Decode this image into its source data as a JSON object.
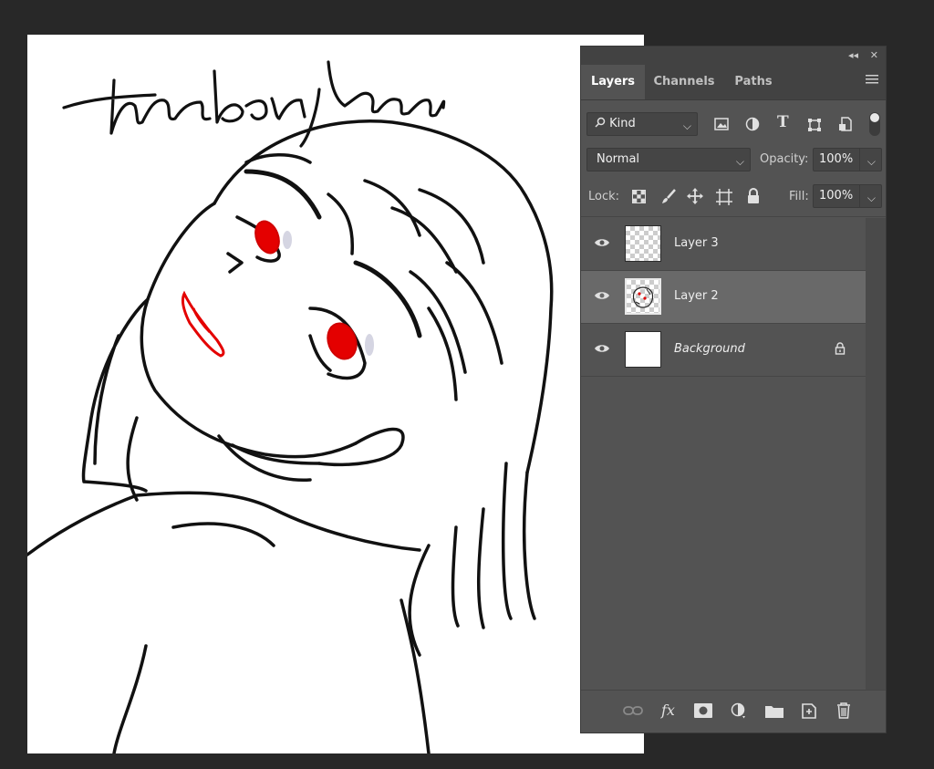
{
  "panel": {
    "tabs": [
      {
        "label": "Layers",
        "active": true
      },
      {
        "label": "Channels",
        "active": false
      },
      {
        "label": "Paths",
        "active": false
      }
    ],
    "filter": {
      "label": "Kind"
    },
    "blend_mode": "Normal",
    "opacity": {
      "label": "Opacity:",
      "value": "100%"
    },
    "lock": {
      "label": "Lock:"
    },
    "fill": {
      "label": "Fill:",
      "value": "100%"
    },
    "layers": [
      {
        "name": "Layer 3",
        "visible": true,
        "selected": false
      },
      {
        "name": "Layer 2",
        "visible": true,
        "selected": true
      },
      {
        "name": "Background",
        "visible": true,
        "locked": true
      }
    ],
    "bottom_icons": [
      "link-icon",
      "fx-icon",
      "mask-icon",
      "adjustment-icon",
      "folder-icon",
      "new-layer-icon",
      "trash-icon"
    ]
  },
  "canvas": {
    "signature_text": "haibangkang"
  },
  "colors": {
    "panel_bg": "#535353",
    "selected_row": "#696969",
    "lip_eye_red": "#e40000"
  }
}
